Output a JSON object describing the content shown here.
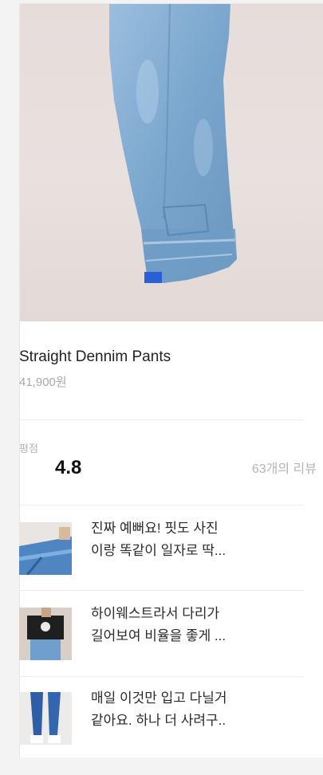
{
  "product": {
    "name": "Straight Dennim Pants",
    "price": "41,900원"
  },
  "rating": {
    "label": "평점",
    "value": "4.8",
    "review_count": "63개의 리뷰"
  },
  "reviews": [
    {
      "line1": "진짜 예뻐요! 핏도 사진",
      "line2": "이랑 똑같이 일자로 딱..."
    },
    {
      "line1": "하이웨스트라서 다리가",
      "line2": "길어보여 비율을 좋게 ..."
    },
    {
      "line1": "매일 이것만 입고 다닐거",
      "line2": "같아요. 하나 더 사려구.."
    }
  ],
  "colors": {
    "background": "#f3f3f3",
    "card": "#ffffff",
    "denim": "#7fa9cf",
    "muted_text": "#b3b3b3"
  }
}
